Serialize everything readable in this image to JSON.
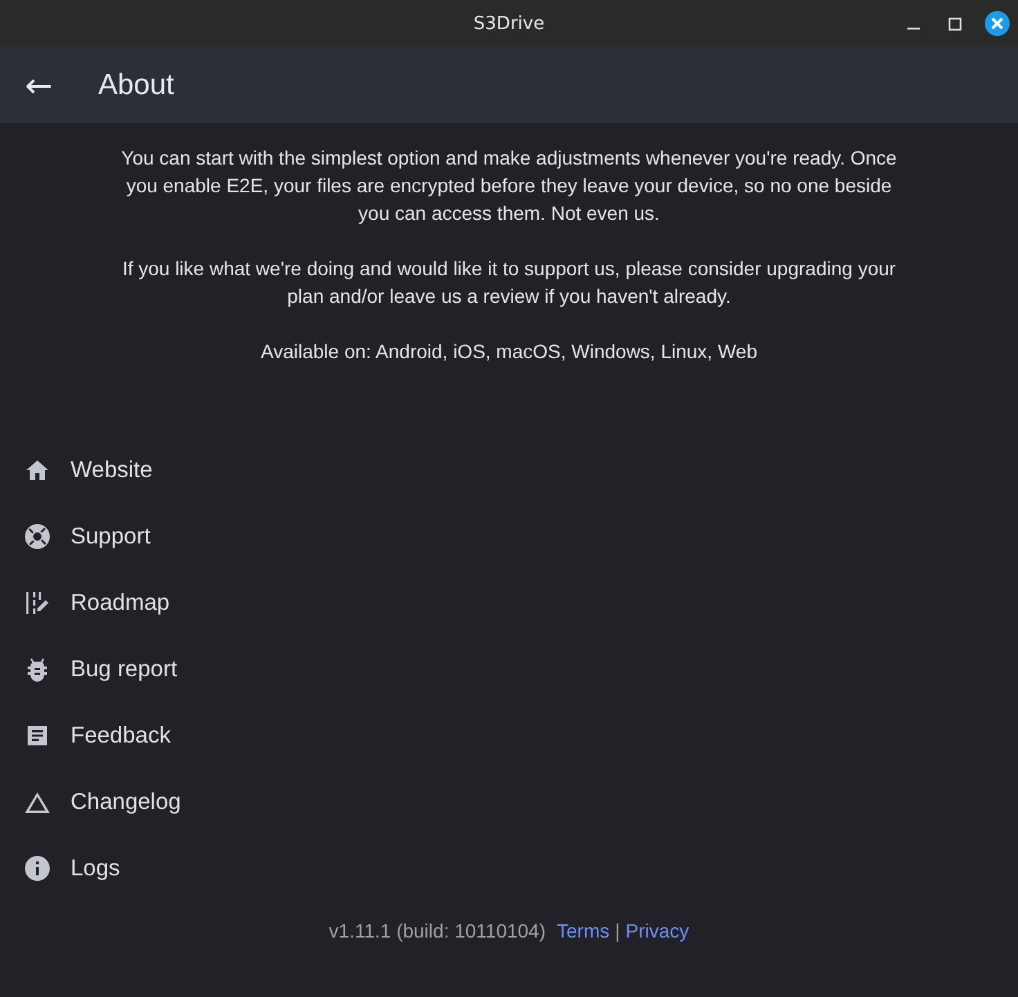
{
  "window": {
    "title": "S3Drive"
  },
  "app_bar": {
    "back": "←",
    "title": "About"
  },
  "paragraphs": [
    "You can start with the simplest option and make adjustments whenever you're ready. Once you enable E2E, your files are encrypted before they leave your device, so no one beside you can access them. Not even us.",
    "If you like what we're doing and would like it to support us, please consider upgrading your plan and/or leave us a review if you haven't already.",
    "Available on: Android, iOS, macOS, Windows, Linux, Web"
  ],
  "menu": [
    {
      "label": "Website"
    },
    {
      "label": "Support"
    },
    {
      "label": "Roadmap"
    },
    {
      "label": "Bug report"
    },
    {
      "label": "Feedback"
    },
    {
      "label": "Changelog"
    },
    {
      "label": "Logs"
    }
  ],
  "footer": {
    "version": "v1.11.1 (build: 10110104)",
    "links": [
      "Terms",
      "Privacy"
    ],
    "separator": "|"
  }
}
